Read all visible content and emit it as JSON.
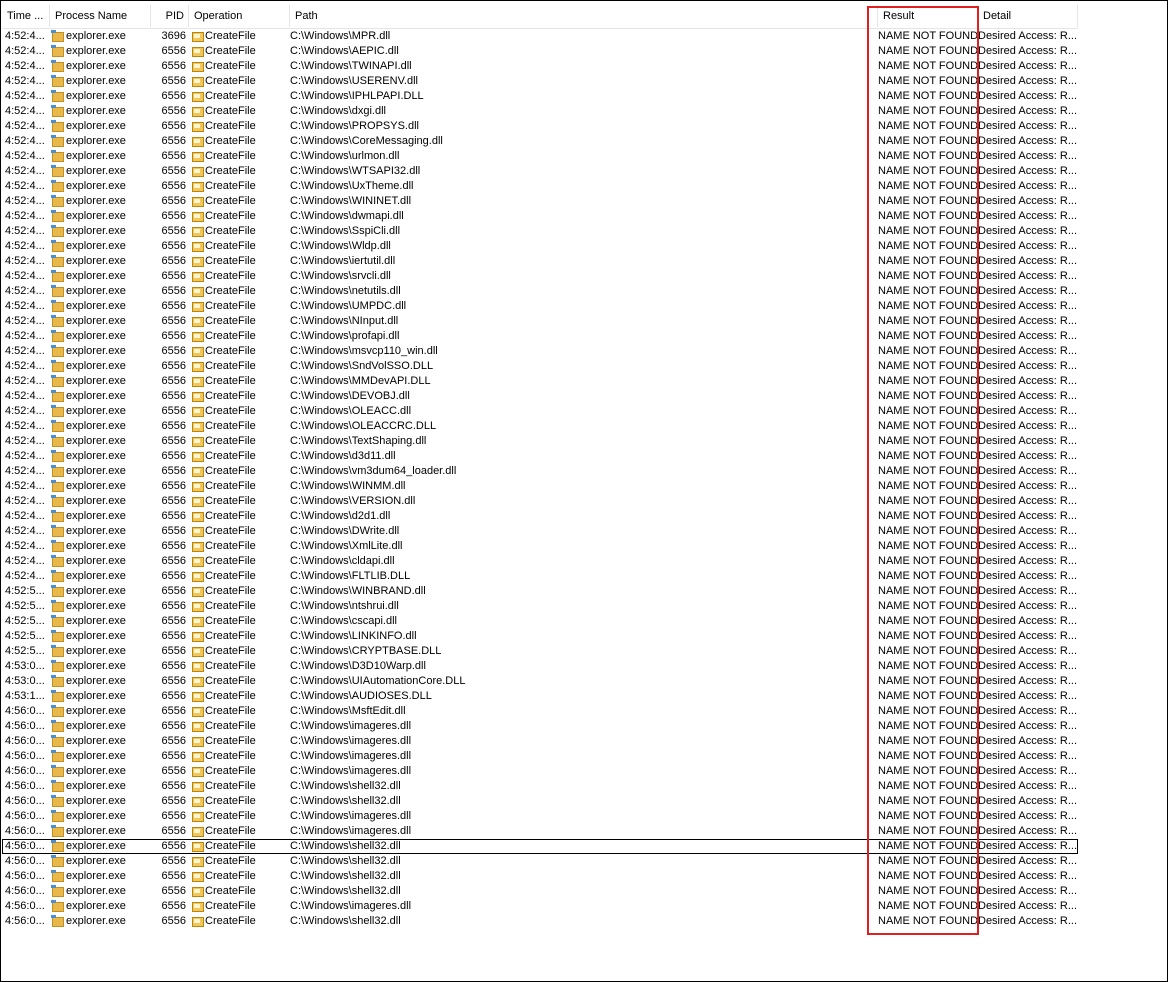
{
  "columns": {
    "time": "Time ...",
    "process": "Process Name",
    "pid": "PID",
    "operation": "Operation",
    "path": "Path",
    "result": "Result",
    "detail": "Detail"
  },
  "icons": {
    "process": "explorer-folder-icon",
    "operation": "filesystem-createfile-icon"
  },
  "highlight_color": "#e02020",
  "rows": [
    {
      "time": "4:52:4...",
      "process": "explorer.exe",
      "pid": "3696",
      "operation": "CreateFile",
      "path": "C:\\Windows\\MPR.dll",
      "result": "NAME NOT FOUND",
      "detail": "Desired Access: R..."
    },
    {
      "time": "4:52:4...",
      "process": "explorer.exe",
      "pid": "6556",
      "operation": "CreateFile",
      "path": "C:\\Windows\\AEPIC.dll",
      "result": "NAME NOT FOUND",
      "detail": "Desired Access: R..."
    },
    {
      "time": "4:52:4...",
      "process": "explorer.exe",
      "pid": "6556",
      "operation": "CreateFile",
      "path": "C:\\Windows\\TWINAPI.dll",
      "result": "NAME NOT FOUND",
      "detail": "Desired Access: R..."
    },
    {
      "time": "4:52:4...",
      "process": "explorer.exe",
      "pid": "6556",
      "operation": "CreateFile",
      "path": "C:\\Windows\\USERENV.dll",
      "result": "NAME NOT FOUND",
      "detail": "Desired Access: R..."
    },
    {
      "time": "4:52:4...",
      "process": "explorer.exe",
      "pid": "6556",
      "operation": "CreateFile",
      "path": "C:\\Windows\\IPHLPAPI.DLL",
      "result": "NAME NOT FOUND",
      "detail": "Desired Access: R..."
    },
    {
      "time": "4:52:4...",
      "process": "explorer.exe",
      "pid": "6556",
      "operation": "CreateFile",
      "path": "C:\\Windows\\dxgi.dll",
      "result": "NAME NOT FOUND",
      "detail": "Desired Access: R..."
    },
    {
      "time": "4:52:4...",
      "process": "explorer.exe",
      "pid": "6556",
      "operation": "CreateFile",
      "path": "C:\\Windows\\PROPSYS.dll",
      "result": "NAME NOT FOUND",
      "detail": "Desired Access: R..."
    },
    {
      "time": "4:52:4...",
      "process": "explorer.exe",
      "pid": "6556",
      "operation": "CreateFile",
      "path": "C:\\Windows\\CoreMessaging.dll",
      "result": "NAME NOT FOUND",
      "detail": "Desired Access: R..."
    },
    {
      "time": "4:52:4...",
      "process": "explorer.exe",
      "pid": "6556",
      "operation": "CreateFile",
      "path": "C:\\Windows\\urlmon.dll",
      "result": "NAME NOT FOUND",
      "detail": "Desired Access: R..."
    },
    {
      "time": "4:52:4...",
      "process": "explorer.exe",
      "pid": "6556",
      "operation": "CreateFile",
      "path": "C:\\Windows\\WTSAPI32.dll",
      "result": "NAME NOT FOUND",
      "detail": "Desired Access: R..."
    },
    {
      "time": "4:52:4...",
      "process": "explorer.exe",
      "pid": "6556",
      "operation": "CreateFile",
      "path": "C:\\Windows\\UxTheme.dll",
      "result": "NAME NOT FOUND",
      "detail": "Desired Access: R..."
    },
    {
      "time": "4:52:4...",
      "process": "explorer.exe",
      "pid": "6556",
      "operation": "CreateFile",
      "path": "C:\\Windows\\WININET.dll",
      "result": "NAME NOT FOUND",
      "detail": "Desired Access: R..."
    },
    {
      "time": "4:52:4...",
      "process": "explorer.exe",
      "pid": "6556",
      "operation": "CreateFile",
      "path": "C:\\Windows\\dwmapi.dll",
      "result": "NAME NOT FOUND",
      "detail": "Desired Access: R..."
    },
    {
      "time": "4:52:4...",
      "process": "explorer.exe",
      "pid": "6556",
      "operation": "CreateFile",
      "path": "C:\\Windows\\SspiCli.dll",
      "result": "NAME NOT FOUND",
      "detail": "Desired Access: R..."
    },
    {
      "time": "4:52:4...",
      "process": "explorer.exe",
      "pid": "6556",
      "operation": "CreateFile",
      "path": "C:\\Windows\\Wldp.dll",
      "result": "NAME NOT FOUND",
      "detail": "Desired Access: R..."
    },
    {
      "time": "4:52:4...",
      "process": "explorer.exe",
      "pid": "6556",
      "operation": "CreateFile",
      "path": "C:\\Windows\\iertutil.dll",
      "result": "NAME NOT FOUND",
      "detail": "Desired Access: R..."
    },
    {
      "time": "4:52:4...",
      "process": "explorer.exe",
      "pid": "6556",
      "operation": "CreateFile",
      "path": "C:\\Windows\\srvcli.dll",
      "result": "NAME NOT FOUND",
      "detail": "Desired Access: R..."
    },
    {
      "time": "4:52:4...",
      "process": "explorer.exe",
      "pid": "6556",
      "operation": "CreateFile",
      "path": "C:\\Windows\\netutils.dll",
      "result": "NAME NOT FOUND",
      "detail": "Desired Access: R..."
    },
    {
      "time": "4:52:4...",
      "process": "explorer.exe",
      "pid": "6556",
      "operation": "CreateFile",
      "path": "C:\\Windows\\UMPDC.dll",
      "result": "NAME NOT FOUND",
      "detail": "Desired Access: R..."
    },
    {
      "time": "4:52:4...",
      "process": "explorer.exe",
      "pid": "6556",
      "operation": "CreateFile",
      "path": "C:\\Windows\\NInput.dll",
      "result": "NAME NOT FOUND",
      "detail": "Desired Access: R..."
    },
    {
      "time": "4:52:4...",
      "process": "explorer.exe",
      "pid": "6556",
      "operation": "CreateFile",
      "path": "C:\\Windows\\profapi.dll",
      "result": "NAME NOT FOUND",
      "detail": "Desired Access: R..."
    },
    {
      "time": "4:52:4...",
      "process": "explorer.exe",
      "pid": "6556",
      "operation": "CreateFile",
      "path": "C:\\Windows\\msvcp110_win.dll",
      "result": "NAME NOT FOUND",
      "detail": "Desired Access: R..."
    },
    {
      "time": "4:52:4...",
      "process": "explorer.exe",
      "pid": "6556",
      "operation": "CreateFile",
      "path": "C:\\Windows\\SndVolSSO.DLL",
      "result": "NAME NOT FOUND",
      "detail": "Desired Access: R..."
    },
    {
      "time": "4:52:4...",
      "process": "explorer.exe",
      "pid": "6556",
      "operation": "CreateFile",
      "path": "C:\\Windows\\MMDevAPI.DLL",
      "result": "NAME NOT FOUND",
      "detail": "Desired Access: R..."
    },
    {
      "time": "4:52:4...",
      "process": "explorer.exe",
      "pid": "6556",
      "operation": "CreateFile",
      "path": "C:\\Windows\\DEVOBJ.dll",
      "result": "NAME NOT FOUND",
      "detail": "Desired Access: R..."
    },
    {
      "time": "4:52:4...",
      "process": "explorer.exe",
      "pid": "6556",
      "operation": "CreateFile",
      "path": "C:\\Windows\\OLEACC.dll",
      "result": "NAME NOT FOUND",
      "detail": "Desired Access: R..."
    },
    {
      "time": "4:52:4...",
      "process": "explorer.exe",
      "pid": "6556",
      "operation": "CreateFile",
      "path": "C:\\Windows\\OLEACCRC.DLL",
      "result": "NAME NOT FOUND",
      "detail": "Desired Access: R..."
    },
    {
      "time": "4:52:4...",
      "process": "explorer.exe",
      "pid": "6556",
      "operation": "CreateFile",
      "path": "C:\\Windows\\TextShaping.dll",
      "result": "NAME NOT FOUND",
      "detail": "Desired Access: R..."
    },
    {
      "time": "4:52:4...",
      "process": "explorer.exe",
      "pid": "6556",
      "operation": "CreateFile",
      "path": "C:\\Windows\\d3d11.dll",
      "result": "NAME NOT FOUND",
      "detail": "Desired Access: R..."
    },
    {
      "time": "4:52:4...",
      "process": "explorer.exe",
      "pid": "6556",
      "operation": "CreateFile",
      "path": "C:\\Windows\\vm3dum64_loader.dll",
      "result": "NAME NOT FOUND",
      "detail": "Desired Access: R..."
    },
    {
      "time": "4:52:4...",
      "process": "explorer.exe",
      "pid": "6556",
      "operation": "CreateFile",
      "path": "C:\\Windows\\WINMM.dll",
      "result": "NAME NOT FOUND",
      "detail": "Desired Access: R..."
    },
    {
      "time": "4:52:4...",
      "process": "explorer.exe",
      "pid": "6556",
      "operation": "CreateFile",
      "path": "C:\\Windows\\VERSION.dll",
      "result": "NAME NOT FOUND",
      "detail": "Desired Access: R..."
    },
    {
      "time": "4:52:4...",
      "process": "explorer.exe",
      "pid": "6556",
      "operation": "CreateFile",
      "path": "C:\\Windows\\d2d1.dll",
      "result": "NAME NOT FOUND",
      "detail": "Desired Access: R..."
    },
    {
      "time": "4:52:4...",
      "process": "explorer.exe",
      "pid": "6556",
      "operation": "CreateFile",
      "path": "C:\\Windows\\DWrite.dll",
      "result": "NAME NOT FOUND",
      "detail": "Desired Access: R..."
    },
    {
      "time": "4:52:4...",
      "process": "explorer.exe",
      "pid": "6556",
      "operation": "CreateFile",
      "path": "C:\\Windows\\XmlLite.dll",
      "result": "NAME NOT FOUND",
      "detail": "Desired Access: R..."
    },
    {
      "time": "4:52:4...",
      "process": "explorer.exe",
      "pid": "6556",
      "operation": "CreateFile",
      "path": "C:\\Windows\\cldapi.dll",
      "result": "NAME NOT FOUND",
      "detail": "Desired Access: R..."
    },
    {
      "time": "4:52:4...",
      "process": "explorer.exe",
      "pid": "6556",
      "operation": "CreateFile",
      "path": "C:\\Windows\\FLTLIB.DLL",
      "result": "NAME NOT FOUND",
      "detail": "Desired Access: R..."
    },
    {
      "time": "4:52:5...",
      "process": "explorer.exe",
      "pid": "6556",
      "operation": "CreateFile",
      "path": "C:\\Windows\\WINBRAND.dll",
      "result": "NAME NOT FOUND",
      "detail": "Desired Access: R..."
    },
    {
      "time": "4:52:5...",
      "process": "explorer.exe",
      "pid": "6556",
      "operation": "CreateFile",
      "path": "C:\\Windows\\ntshrui.dll",
      "result": "NAME NOT FOUND",
      "detail": "Desired Access: R..."
    },
    {
      "time": "4:52:5...",
      "process": "explorer.exe",
      "pid": "6556",
      "operation": "CreateFile",
      "path": "C:\\Windows\\cscapi.dll",
      "result": "NAME NOT FOUND",
      "detail": "Desired Access: R..."
    },
    {
      "time": "4:52:5...",
      "process": "explorer.exe",
      "pid": "6556",
      "operation": "CreateFile",
      "path": "C:\\Windows\\LINKINFO.dll",
      "result": "NAME NOT FOUND",
      "detail": "Desired Access: R..."
    },
    {
      "time": "4:52:5...",
      "process": "explorer.exe",
      "pid": "6556",
      "operation": "CreateFile",
      "path": "C:\\Windows\\CRYPTBASE.DLL",
      "result": "NAME NOT FOUND",
      "detail": "Desired Access: R..."
    },
    {
      "time": "4:53:0...",
      "process": "explorer.exe",
      "pid": "6556",
      "operation": "CreateFile",
      "path": "C:\\Windows\\D3D10Warp.dll",
      "result": "NAME NOT FOUND",
      "detail": "Desired Access: R..."
    },
    {
      "time": "4:53:0...",
      "process": "explorer.exe",
      "pid": "6556",
      "operation": "CreateFile",
      "path": "C:\\Windows\\UIAutomationCore.DLL",
      "result": "NAME NOT FOUND",
      "detail": "Desired Access: R..."
    },
    {
      "time": "4:53:1...",
      "process": "explorer.exe",
      "pid": "6556",
      "operation": "CreateFile",
      "path": "C:\\Windows\\AUDIOSES.DLL",
      "result": "NAME NOT FOUND",
      "detail": "Desired Access: R..."
    },
    {
      "time": "4:56:0...",
      "process": "explorer.exe",
      "pid": "6556",
      "operation": "CreateFile",
      "path": "C:\\Windows\\MsftEdit.dll",
      "result": "NAME NOT FOUND",
      "detail": "Desired Access: R..."
    },
    {
      "time": "4:56:0...",
      "process": "explorer.exe",
      "pid": "6556",
      "operation": "CreateFile",
      "path": "C:\\Windows\\imageres.dll",
      "result": "NAME NOT FOUND",
      "detail": "Desired Access: R..."
    },
    {
      "time": "4:56:0...",
      "process": "explorer.exe",
      "pid": "6556",
      "operation": "CreateFile",
      "path": "C:\\Windows\\imageres.dll",
      "result": "NAME NOT FOUND",
      "detail": "Desired Access: R..."
    },
    {
      "time": "4:56:0...",
      "process": "explorer.exe",
      "pid": "6556",
      "operation": "CreateFile",
      "path": "C:\\Windows\\imageres.dll",
      "result": "NAME NOT FOUND",
      "detail": "Desired Access: R..."
    },
    {
      "time": "4:56:0...",
      "process": "explorer.exe",
      "pid": "6556",
      "operation": "CreateFile",
      "path": "C:\\Windows\\imageres.dll",
      "result": "NAME NOT FOUND",
      "detail": "Desired Access: R..."
    },
    {
      "time": "4:56:0...",
      "process": "explorer.exe",
      "pid": "6556",
      "operation": "CreateFile",
      "path": "C:\\Windows\\shell32.dll",
      "result": "NAME NOT FOUND",
      "detail": "Desired Access: R..."
    },
    {
      "time": "4:56:0...",
      "process": "explorer.exe",
      "pid": "6556",
      "operation": "CreateFile",
      "path": "C:\\Windows\\shell32.dll",
      "result": "NAME NOT FOUND",
      "detail": "Desired Access: R..."
    },
    {
      "time": "4:56:0...",
      "process": "explorer.exe",
      "pid": "6556",
      "operation": "CreateFile",
      "path": "C:\\Windows\\imageres.dll",
      "result": "NAME NOT FOUND",
      "detail": "Desired Access: R..."
    },
    {
      "time": "4:56:0...",
      "process": "explorer.exe",
      "pid": "6556",
      "operation": "CreateFile",
      "path": "C:\\Windows\\imageres.dll",
      "result": "NAME NOT FOUND",
      "detail": "Desired Access: R..."
    },
    {
      "time": "4:56:0...",
      "process": "explorer.exe",
      "pid": "6556",
      "operation": "CreateFile",
      "path": "C:\\Windows\\shell32.dll",
      "result": "NAME NOT FOUND",
      "detail": "Desired Access: R...",
      "selected": true
    },
    {
      "time": "4:56:0...",
      "process": "explorer.exe",
      "pid": "6556",
      "operation": "CreateFile",
      "path": "C:\\Windows\\shell32.dll",
      "result": "NAME NOT FOUND",
      "detail": "Desired Access: R..."
    },
    {
      "time": "4:56:0...",
      "process": "explorer.exe",
      "pid": "6556",
      "operation": "CreateFile",
      "path": "C:\\Windows\\shell32.dll",
      "result": "NAME NOT FOUND",
      "detail": "Desired Access: R..."
    },
    {
      "time": "4:56:0...",
      "process": "explorer.exe",
      "pid": "6556",
      "operation": "CreateFile",
      "path": "C:\\Windows\\shell32.dll",
      "result": "NAME NOT FOUND",
      "detail": "Desired Access: R..."
    },
    {
      "time": "4:56:0...",
      "process": "explorer.exe",
      "pid": "6556",
      "operation": "CreateFile",
      "path": "C:\\Windows\\imageres.dll",
      "result": "NAME NOT FOUND",
      "detail": "Desired Access: R..."
    },
    {
      "time": "4:56:0...",
      "process": "explorer.exe",
      "pid": "6556",
      "operation": "CreateFile",
      "path": "C:\\Windows\\shell32.dll",
      "result": "NAME NOT FOUND",
      "detail": "Desired Access: R..."
    }
  ]
}
